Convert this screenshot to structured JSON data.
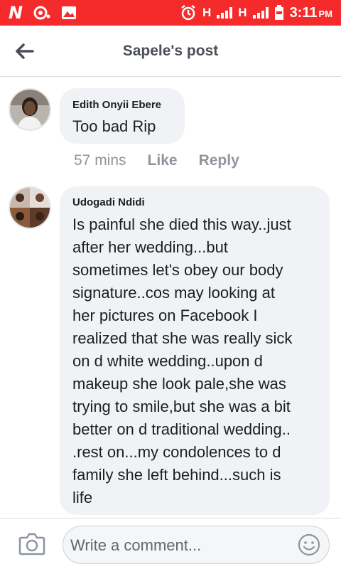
{
  "status_bar": {
    "carrier_icon": "N",
    "signal_label_1": "H",
    "signal_label_2": "H",
    "time": "3:11",
    "ampm": "PM"
  },
  "header": {
    "title": "Sapele's post",
    "back_icon": "arrow-left"
  },
  "comments": [
    {
      "author": "Edith Onyii Ebere",
      "text": "Too bad Rip",
      "time": "57 mins",
      "like": "Like",
      "reply": "Reply"
    },
    {
      "author": "Udogadi Ndidi",
      "lines": [
        "Is painful she died this way..just",
        "after her wedding...but",
        "sometimes let's obey our body",
        "signature..cos may looking at",
        "her pictures on Facebook I",
        "realized that she was really sick",
        "on d white wedding..upon d",
        "makeup she look pale,she was",
        "trying to smile,but she was a bit",
        "better on d traditional wedding..",
        ".rest on...my condolences to d",
        "family she left behind...such is",
        "life"
      ]
    }
  ],
  "composer": {
    "placeholder": "Write a comment...",
    "camera_icon": "camera",
    "emoji_icon": "smiley"
  },
  "colors": {
    "status_bar": "#f52a2a",
    "bubble": "#f0f2f5",
    "muted_text": "#90949c"
  }
}
